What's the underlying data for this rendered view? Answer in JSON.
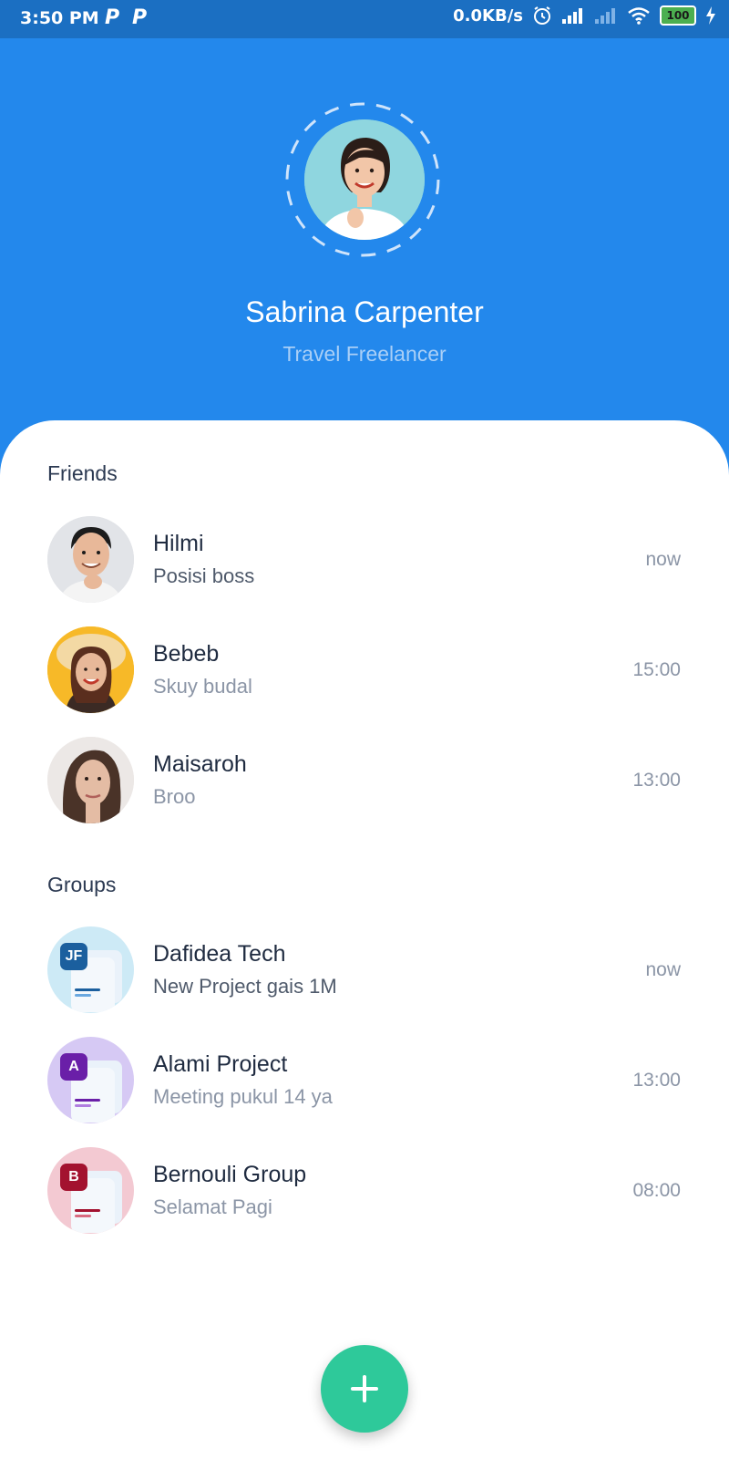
{
  "status_bar": {
    "time": "3:50 PM",
    "notif_1": "P",
    "notif_2": "P",
    "net_speed": "0.0KB/s",
    "battery": "100",
    "icons": [
      "alarm-icon",
      "signal-icon",
      "signal-off-icon",
      "wifi-icon",
      "battery-icon",
      "charging-icon"
    ]
  },
  "profile": {
    "name": "Sabrina Carpenter",
    "role": "Travel Freelancer"
  },
  "friends": {
    "title": "Friends",
    "items": [
      {
        "name": "Hilmi",
        "message": "Posisi boss",
        "time": "now",
        "unread": true
      },
      {
        "name": "Bebeb",
        "message": "Skuy budal",
        "time": "15:00",
        "unread": false
      },
      {
        "name": "Maisaroh",
        "message": "Broo",
        "time": "13:00",
        "unread": false
      }
    ]
  },
  "groups": {
    "title": "Groups",
    "items": [
      {
        "name": "Dafidea Tech",
        "message": "New Project gais 1M",
        "time": "now",
        "badge": "JF",
        "unread": true,
        "color": "#1b5f9e",
        "bg": "#cdeaf6"
      },
      {
        "name": "Alami Project",
        "message": "Meeting pukul 14 ya",
        "time": "13:00",
        "badge": "A",
        "unread": false,
        "color": "#6a1fa8",
        "bg": "#d6c9f4"
      },
      {
        "name": "Bernouli Group",
        "message": "Selamat Pagi",
        "time": "08:00",
        "badge": "B",
        "unread": false,
        "color": "#a3122f",
        "bg": "#f3c9d2"
      }
    ]
  },
  "colors": {
    "header_bg": "#2388ec",
    "status_bg": "#1b6fc2",
    "fab": "#2ec99a"
  },
  "fab": {
    "icon": "plus-icon"
  }
}
